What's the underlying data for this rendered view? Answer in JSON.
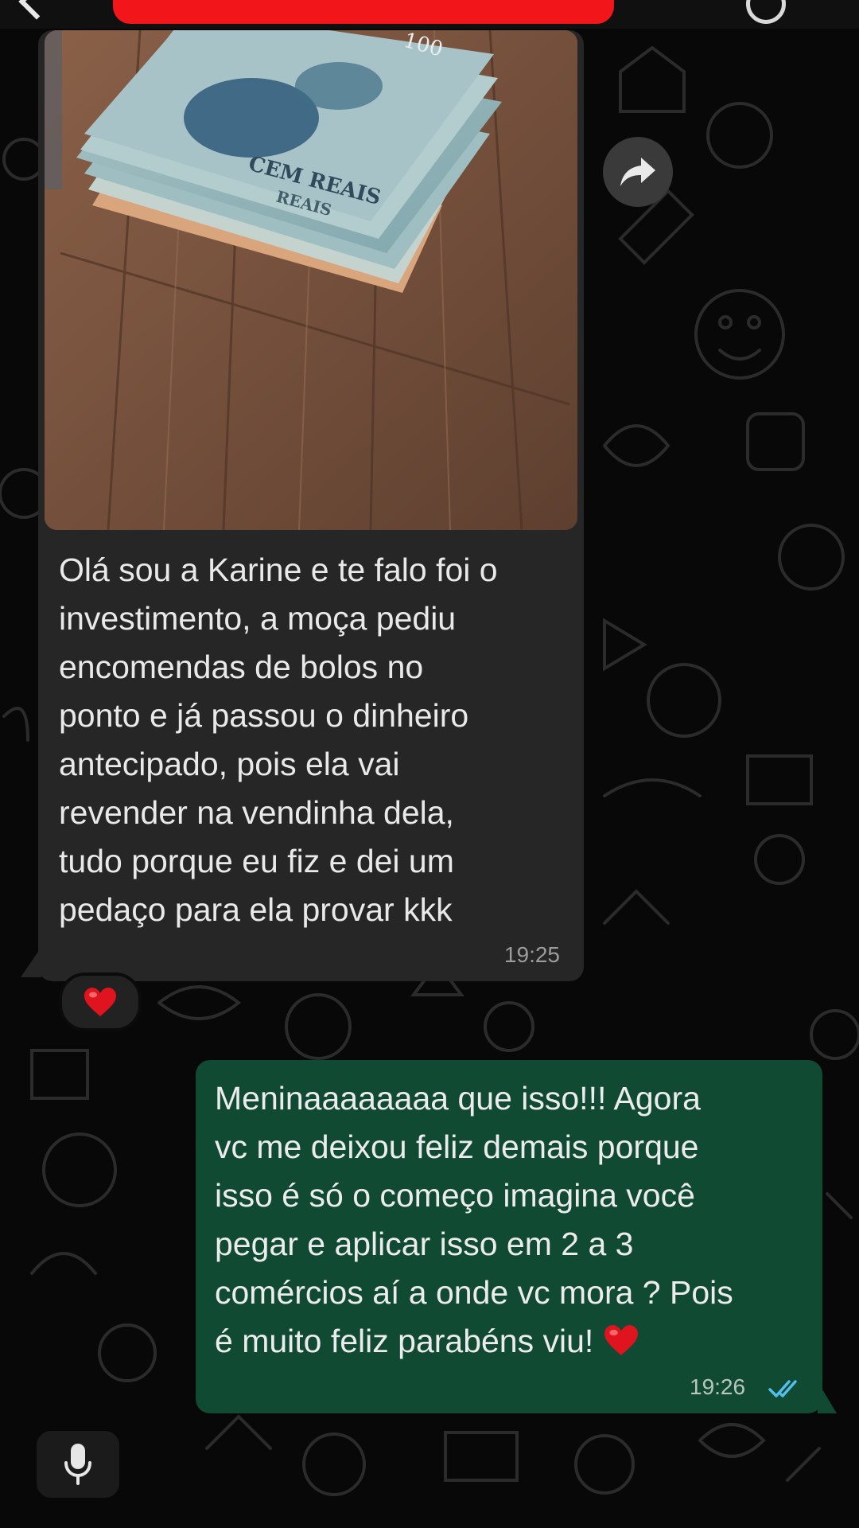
{
  "chat": {
    "incoming": {
      "text": "Olá sou a Karine e te falo foi o\ninvestimento, a moça pediu\nencomendas de bolos no\nponto e já passou o dinheiro\nantecipado, pois ela vai\nrevender na vendinha dela,\ntudo porque eu fiz e dei um\npedaço para ela provar kkk",
      "time": "19:25",
      "reaction": "heart",
      "photo_text": "CEM REAIS",
      "photo_text_2": "REAIS",
      "photo_denomination": "100"
    },
    "outgoing": {
      "text": "Meninaaaaaaaa que isso!!! Agora\nvc me deixou feliz demais porque\nisso é só o começo imagina você\npegar e aplicar isso em 2 a 3\ncomércios aí a onde vc mora ? Pois\né muito feliz parabéns viu!",
      "time": "19:26",
      "status": "read"
    }
  },
  "colors": {
    "incoming_bubble": "#262626",
    "outgoing_bubble": "#104a33",
    "read_ticks": "#53bdeb",
    "heart": "#e0141e",
    "redaction": "#f2161b"
  },
  "icons": [
    "back-chevron-icon",
    "forward-icon",
    "heart-icon",
    "double-check-icon",
    "microphone-icon"
  ]
}
